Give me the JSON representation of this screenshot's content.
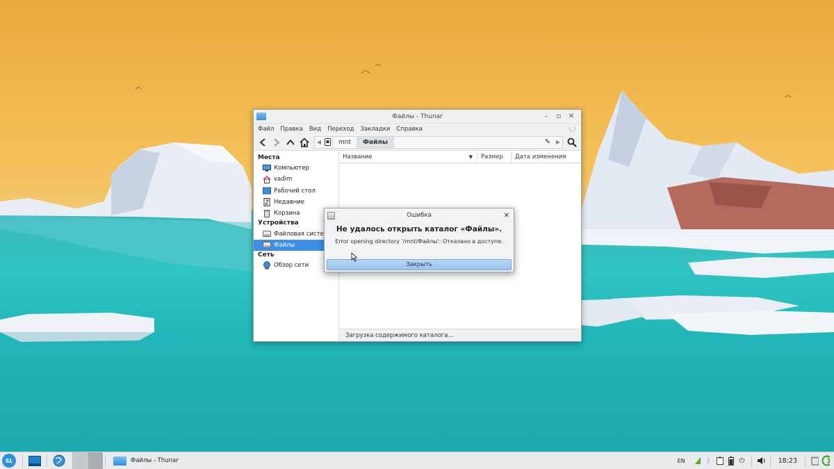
{
  "window": {
    "title": "Файлы - Thunar",
    "menu": [
      "Файл",
      "Правка",
      "Вид",
      "Переход",
      "Закладки",
      "Справка"
    ],
    "path": {
      "parent": "mnt",
      "current": "Файлы"
    },
    "sidebar": {
      "places_heading": "Места",
      "places": [
        {
          "label": "Компьютер",
          "icon": "computer-icon"
        },
        {
          "label": "vadim",
          "icon": "home-icon"
        },
        {
          "label": "Рабочий стол",
          "icon": "desktop-icon"
        },
        {
          "label": "Недавние",
          "icon": "recent-icon"
        },
        {
          "label": "Корзина",
          "icon": "trash-icon"
        }
      ],
      "devices_heading": "Устройства",
      "devices": [
        {
          "label": "Файловая система",
          "icon": "drive-icon"
        },
        {
          "label": "Файлы",
          "icon": "drive-icon",
          "selected": true
        }
      ],
      "network_heading": "Сеть",
      "network": [
        {
          "label": "Обзор сети",
          "icon": "network-icon"
        }
      ]
    },
    "columns": {
      "name": "Название",
      "size": "Размер",
      "date": "Дата изменения"
    },
    "status": "Загрузка содержимого каталога..."
  },
  "dialog": {
    "title": "Ошибка",
    "heading": "Не удалось открыть каталог «Файлы».",
    "message": "Error opening directory '/mnt/Файлы': Отказано в доступе.",
    "button": "Закрыть"
  },
  "taskbar": {
    "start_label": "SL",
    "task_title": "Файлы - Thunar",
    "lang": "EN",
    "clock": "18:23"
  },
  "colors": {
    "accent": "#3d8ee6",
    "button": "#9cc3ee"
  }
}
